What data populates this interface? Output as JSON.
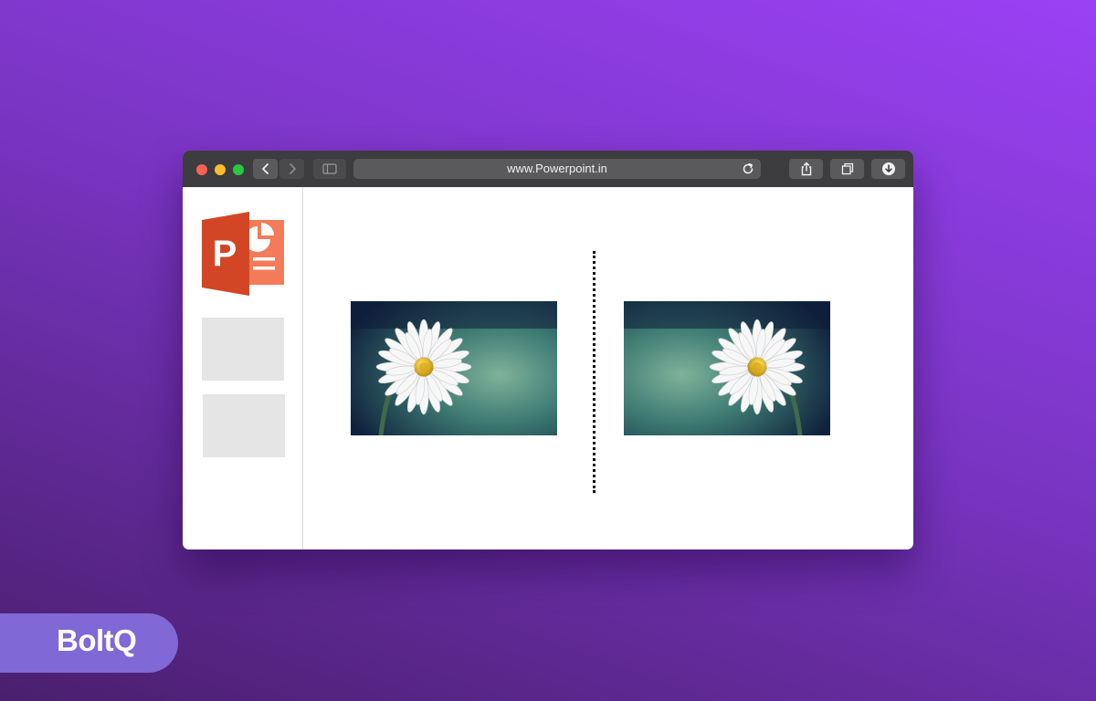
{
  "browser": {
    "url": "www.Powerpoint.in",
    "icons": {
      "back": "chevron-left-icon",
      "forward": "chevron-right-icon",
      "sidebar": "sidebar-toggle-icon",
      "reload": "reload-icon",
      "share": "share-icon",
      "tabs": "tabs-icon",
      "download": "download-icon"
    }
  },
  "sidebar": {
    "logo": "powerpoint-logo",
    "slide_count": 2
  },
  "slide": {
    "images": [
      {
        "name": "daisy-original",
        "subject": "white daisy flower"
      },
      {
        "name": "daisy-flipped",
        "subject": "white daisy flower (mirrored)"
      }
    ]
  },
  "brand": {
    "name": "BoltQ"
  },
  "colors": {
    "background_start": "#9b41f5",
    "background_end": "#4a1f6e",
    "titlebar": "#3d3c3e",
    "powerpoint_orange": "#d24625",
    "brand_pill": "#8068d6"
  }
}
